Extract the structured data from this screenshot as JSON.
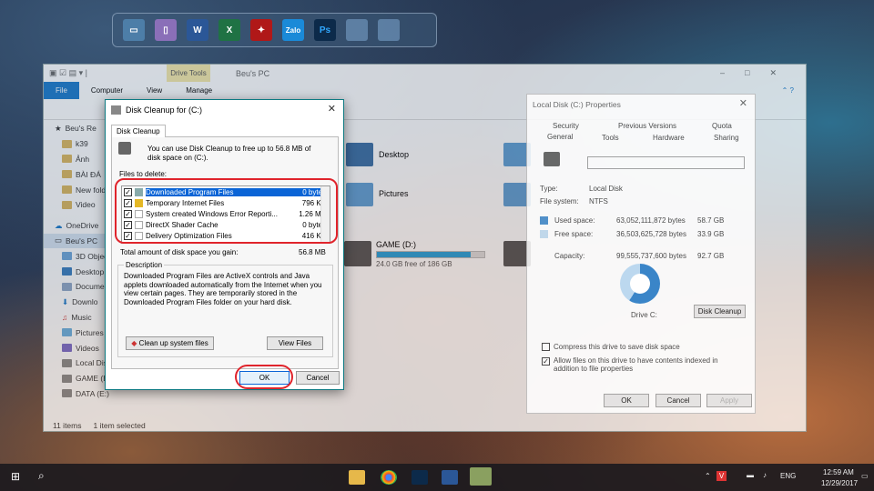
{
  "dock": {
    "icons": [
      "monitor-icon",
      "recycle-bin-icon",
      "word-icon",
      "excel-icon",
      "game-icon",
      "zalo-icon",
      "photoshop-icon",
      "window-icon",
      "window-icon"
    ],
    "labels": {
      "word": "W",
      "excel": "X",
      "zalo": "Zalo",
      "photoshop": "Ps"
    }
  },
  "explorer": {
    "title": "Beu's PC",
    "drive_tools": "Drive Tools",
    "tabs": [
      "File",
      "Computer",
      "View",
      "Manage"
    ],
    "nav_items": [
      "Beu's Re",
      "k39",
      "Ảnh",
      "BÀI ĐÁ",
      "New fold",
      "Video",
      "OneDrive",
      "Beu's PC",
      "3D Objec",
      "Desktop",
      "Docume",
      "Downlo",
      "Music",
      "Pictures",
      "Videos",
      "Local Dis",
      "GAME (E:)",
      "DATA (E:)"
    ],
    "folders": [
      "Desktop",
      "Pictures"
    ],
    "drive_label": "GAME (D:)",
    "drive_free": "24.0 GB free of 186 GB",
    "status_items": "11 items",
    "status_selected": "1 item selected"
  },
  "cleanup": {
    "title": "Disk Cleanup for  (C:)",
    "tab": "Disk Cleanup",
    "intro": "You can use Disk Cleanup to free up to 56.8 MB of disk space on  (C:).",
    "files_label": "Files to delete:",
    "rows": [
      {
        "name": "Downloaded Program Files",
        "size": "0 bytes",
        "checked": true
      },
      {
        "name": "Temporary Internet Files",
        "size": "796 KB",
        "checked": true
      },
      {
        "name": "System created Windows Error Reporti...",
        "size": "1.26 MB",
        "checked": true
      },
      {
        "name": "DirectX Shader Cache",
        "size": "0 bytes",
        "checked": true
      },
      {
        "name": "Delivery Optimization Files",
        "size": "416 KB",
        "checked": true
      }
    ],
    "total_label": "Total amount of disk space you gain:",
    "total_value": "56.8 MB",
    "desc_title": "Description",
    "desc_text": "Downloaded Program Files are ActiveX controls and Java applets downloaded automatically from the Internet when you view certain pages. They are temporarily stored in the Downloaded Program Files folder on your hard disk.",
    "cleanup_system": "Clean up system files",
    "view_files": "View Files",
    "ok": "OK",
    "cancel": "Cancel"
  },
  "props": {
    "title": "Local Disk (C:) Properties",
    "tabs_top": [
      "Security",
      "Previous Versions",
      "Quota"
    ],
    "tabs_bottom": [
      "General",
      "Tools",
      "Hardware",
      "Sharing"
    ],
    "type_label": "Type:",
    "type_value": "Local Disk",
    "fs_label": "File system:",
    "fs_value": "NTFS",
    "used_label": "Used space:",
    "used_bytes": "63,052,111,872 bytes",
    "used_gb": "58.7 GB",
    "free_label": "Free space:",
    "free_bytes": "36,503,625,728 bytes",
    "free_gb": "33.9 GB",
    "cap_label": "Capacity:",
    "cap_bytes": "99,555,737,600 bytes",
    "cap_gb": "92.7 GB",
    "used_fraction": 0.59,
    "drive_label": "Drive C:",
    "disk_cleanup": "Disk Cleanup",
    "compress": "Compress this drive to save disk space",
    "index": "Allow files on this drive to have contents indexed in addition to file properties",
    "ok": "OK",
    "cancel": "Cancel",
    "apply": "Apply"
  },
  "taskbar": {
    "lang": "ENG",
    "time": "12:59 AM",
    "date": "12/29/2017"
  },
  "colors": {
    "accent": "#1979ca",
    "highlight": "#0a64d6",
    "annotation": "#e0242c"
  }
}
